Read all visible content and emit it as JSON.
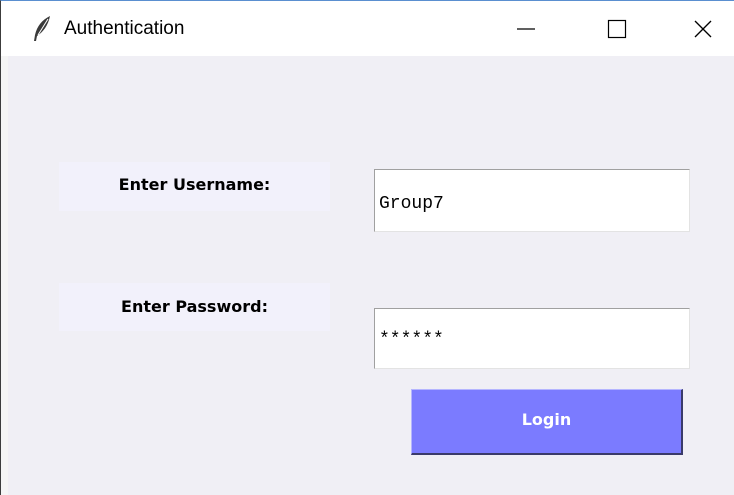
{
  "window": {
    "title": "Authentication",
    "icon": "feather-icon",
    "controls": {
      "minimize": "minimize-icon",
      "maximize": "maximize-icon",
      "close": "close-icon"
    }
  },
  "form": {
    "username": {
      "label": "Enter Username:",
      "value": "Group7"
    },
    "password": {
      "label": "Enter Password:",
      "value": "******"
    },
    "login_label": "Login"
  },
  "colors": {
    "login_button": "#7b7bff",
    "label_background": "#f2f1fb",
    "window_background": "#f0eff5"
  }
}
